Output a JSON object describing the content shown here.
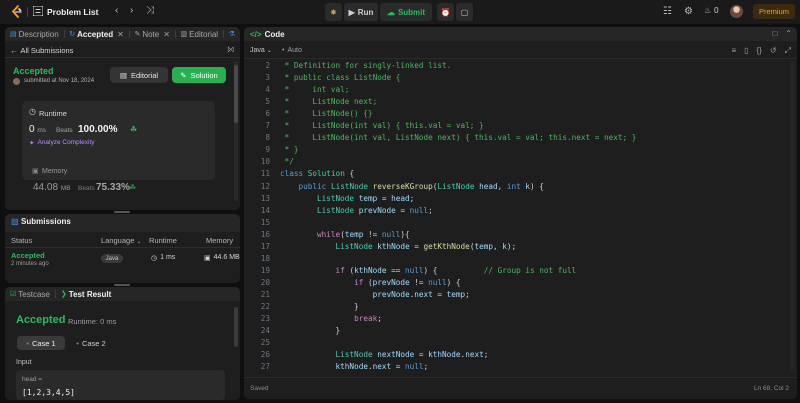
{
  "topbar": {
    "problem_list": "Problem List",
    "run": "Run",
    "submit": "Submit",
    "fire_count": "0",
    "premium": "Premium"
  },
  "left_tabs": [
    {
      "label": "Description",
      "icon": "description-icon"
    },
    {
      "label": "Accepted",
      "icon": "accepted-icon"
    },
    {
      "label": "Note",
      "icon": "note-icon"
    },
    {
      "label": "Editorial",
      "icon": "editorial-icon"
    }
  ],
  "submission": {
    "all_submissions": "All Submissions",
    "status": "Accepted",
    "submitted_at": "submitted at Nov 18, 2024",
    "editorial_btn": "Editorial",
    "solution_btn": "Solution",
    "runtime_label": "Runtime",
    "runtime_value": "0",
    "runtime_unit": "ms",
    "beats_label": "Beats",
    "runtime_beats": "100.00%",
    "analyze": "Analyze Complexity",
    "memory_label": "Memory",
    "memory_value": "44.08",
    "memory_unit": "MB",
    "memory_beats_label": "Beats",
    "memory_beats": "75.33%"
  },
  "submissions": {
    "title": "Submissions",
    "headers": {
      "status": "Status",
      "language": "Language",
      "runtime": "Runtime",
      "memory": "Memory"
    },
    "row": {
      "status": "Accepted",
      "time": "2 minutes ago",
      "language": "Java",
      "runtime": "1 ms",
      "memory": "44.6 MB"
    }
  },
  "testcase": {
    "tab_testcase": "Testcase",
    "tab_result": "Test Result",
    "result": "Accepted",
    "runtime": "Runtime: 0 ms",
    "case1": "Case 1",
    "case2": "Case 2",
    "input_label": "Input",
    "input_var": "head =",
    "input_value": "[1,2,3,4,5]"
  },
  "code": {
    "title": "Code",
    "language": "Java",
    "auto": "Auto",
    "saved": "Saved",
    "cursor": "Ln 68, Col 2",
    "lines": [
      {
        "n": "2",
        "t": " * Definition for singly-linked list."
      },
      {
        "n": "3",
        "t": " * public class ListNode {"
      },
      {
        "n": "4",
        "t": " *     int val;"
      },
      {
        "n": "5",
        "t": " *     ListNode next;"
      },
      {
        "n": "6",
        "t": " *     ListNode() {}"
      },
      {
        "n": "7",
        "t": " *     ListNode(int val) { this.val = val; }"
      },
      {
        "n": "8",
        "t": " *     ListNode(int val, ListNode next) { this.val = val; this.next = next; }"
      },
      {
        "n": "9",
        "t": " * }"
      },
      {
        "n": "10",
        "t": " */"
      },
      {
        "n": "11",
        "t": "class Solution {"
      },
      {
        "n": "12",
        "t": "    public ListNode reverseKGroup(ListNode head, int k) {"
      },
      {
        "n": "13",
        "t": "        ListNode temp = head;"
      },
      {
        "n": "14",
        "t": "        ListNode prevNode = null;"
      },
      {
        "n": "15",
        "t": ""
      },
      {
        "n": "16",
        "t": "        while(temp != null){"
      },
      {
        "n": "17",
        "t": "            ListNode kthNode = getKthNode(temp, k);"
      },
      {
        "n": "18",
        "t": ""
      },
      {
        "n": "19",
        "t": "            if (kthNode == null) {          // Group is not full"
      },
      {
        "n": "20",
        "t": "                if (prevNode != null) {"
      },
      {
        "n": "21",
        "t": "                    prevNode.next = temp;"
      },
      {
        "n": "22",
        "t": "                }"
      },
      {
        "n": "23",
        "t": "                break;"
      },
      {
        "n": "24",
        "t": "            }"
      },
      {
        "n": "25",
        "t": ""
      },
      {
        "n": "26",
        "t": "            ListNode nextNode = kthNode.next;"
      },
      {
        "n": "27",
        "t": "            kthNode.next = null;"
      }
    ]
  }
}
